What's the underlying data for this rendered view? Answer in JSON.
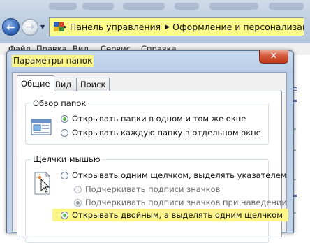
{
  "explorer": {
    "address_crumbs": [
      "Панель управления",
      "Оформление и персонализация"
    ],
    "menu": [
      "Файл",
      "Правка",
      "Вид",
      "Сервис",
      "Справка"
    ]
  },
  "dialog": {
    "title": "Параметры папок",
    "close_label": "✕",
    "tabs": [
      "Общие",
      "Вид",
      "Поиск"
    ],
    "active_tab": "Общие",
    "browse_group": {
      "title": "Обзор папок",
      "options": [
        {
          "label": "Открывать папки в одном и том же окне",
          "checked": true
        },
        {
          "label": "Открывать каждую папку в отдельном окне",
          "checked": false
        }
      ]
    },
    "click_group": {
      "title": "Щелчки мышью",
      "options": [
        {
          "label": "Открывать одним щелчком, выделять указателем",
          "checked": false
        },
        {
          "label": "Подчеркивать подписи значков",
          "checked": false,
          "disabled": true
        },
        {
          "label": "Подчеркивать подписи значков при наведении",
          "checked": true,
          "disabled": true
        },
        {
          "label": "Открывать двойным, а выделять одним щелчком",
          "checked": true
        }
      ]
    }
  },
  "colors": {
    "highlight": "#fbf58a",
    "title_bar": "#c2d4ea",
    "close_button": "#d4573a",
    "radio_checked": "#1d7a17"
  },
  "icons": [
    "back-arrow-icon",
    "forward-arrow-icon",
    "control-panel-icon",
    "folder-window-icon",
    "mouse-click-icon",
    "close-icon"
  ]
}
